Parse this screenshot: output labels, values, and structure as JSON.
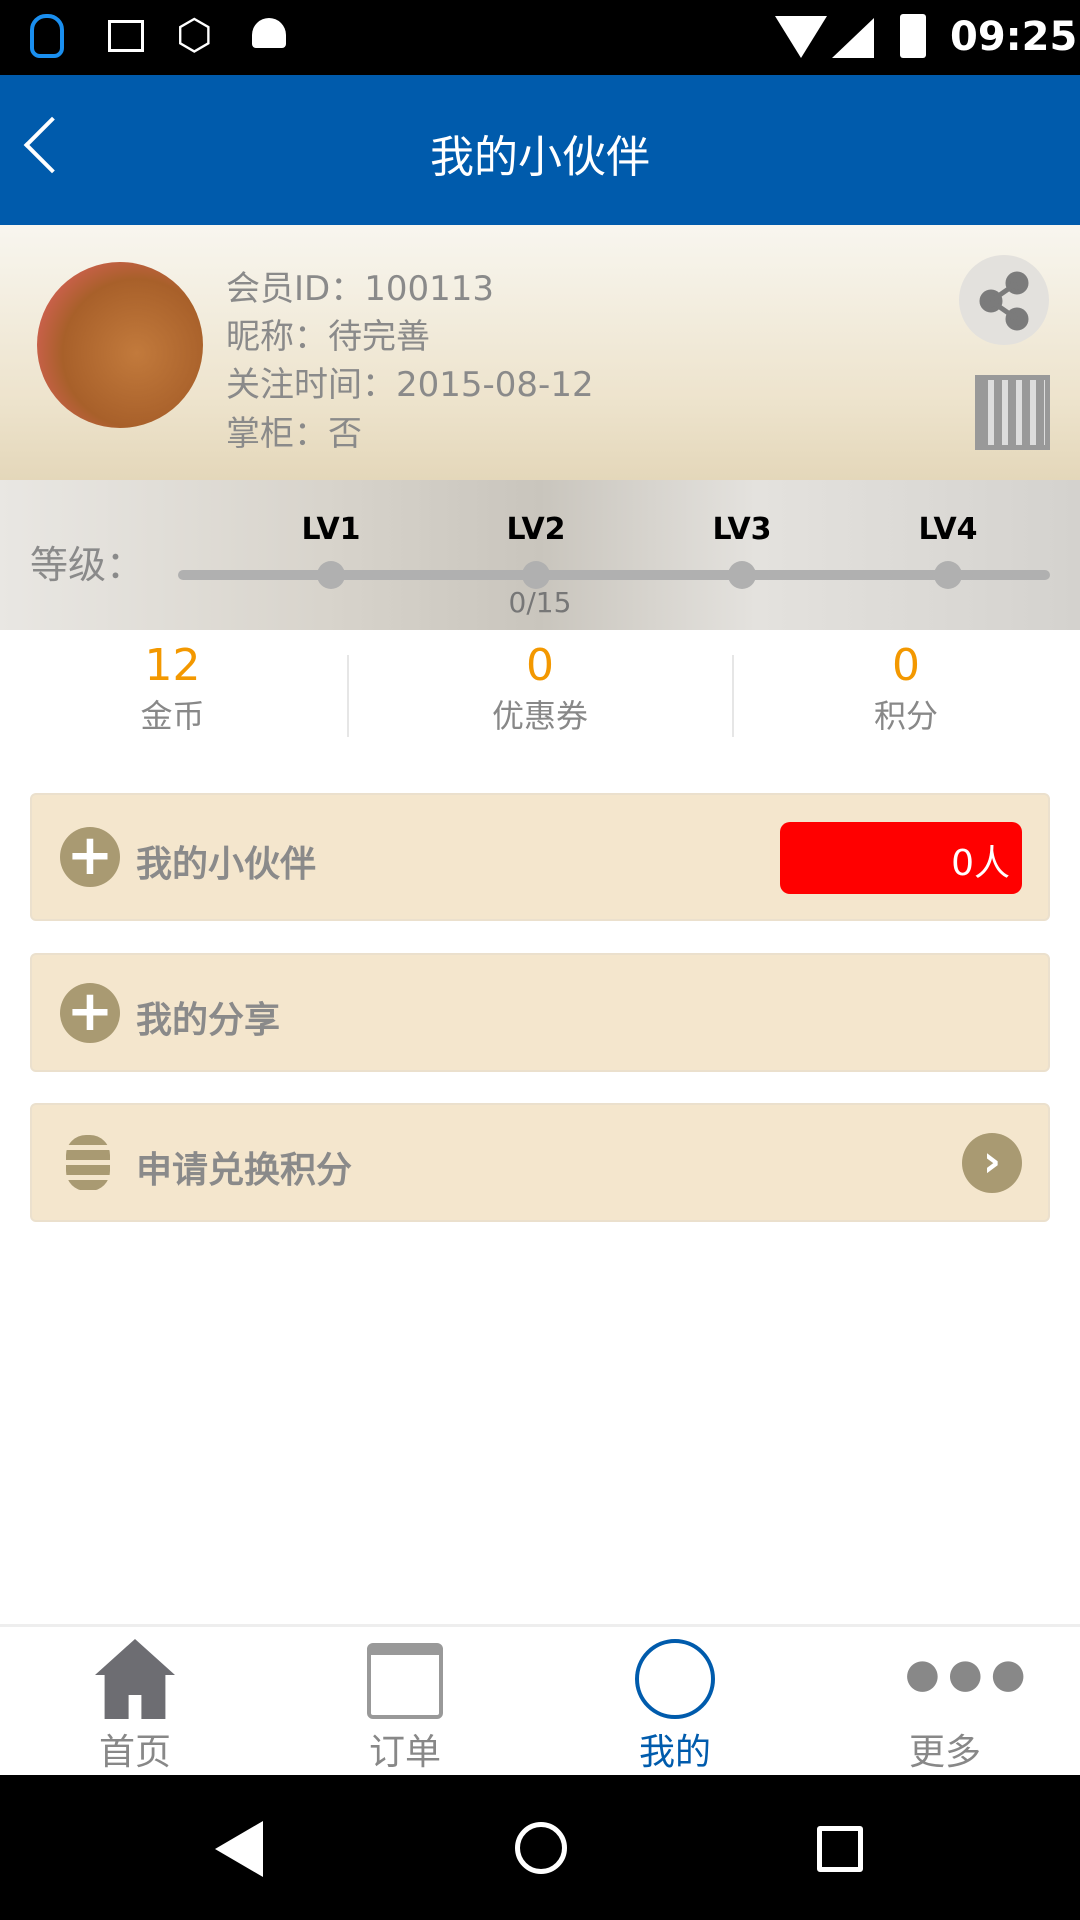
{
  "status_bar": {
    "time": "09:25"
  },
  "header": {
    "title": "我的小伙伴"
  },
  "profile": {
    "member_id": "会员ID：100113",
    "nickname": "昵称：待完善",
    "follow_time": "关注时间：2015-08-12",
    "shopkeeper": "掌柜：否"
  },
  "level": {
    "label": "等级：",
    "levels": [
      "LV1",
      "LV2",
      "LV3",
      "LV4"
    ],
    "progress_text": "0/15",
    "progress": 0
  },
  "stats": [
    {
      "value": "12",
      "label": "金币"
    },
    {
      "value": "0",
      "label": "优惠券"
    },
    {
      "value": "0",
      "label": "积分"
    }
  ],
  "cards": [
    {
      "label": "我的小伙伴",
      "badge": "0人"
    },
    {
      "label": "我的分享"
    },
    {
      "label": "申请兑换积分"
    }
  ],
  "bottom_nav": [
    {
      "label": "首页"
    },
    {
      "label": "订单"
    },
    {
      "label": "我的",
      "active": true
    },
    {
      "label": "更多"
    }
  ],
  "colors": {
    "primary": "#005bac",
    "accent": "#f39800",
    "badge": "#ff0000",
    "card": "#f4e6cd"
  }
}
